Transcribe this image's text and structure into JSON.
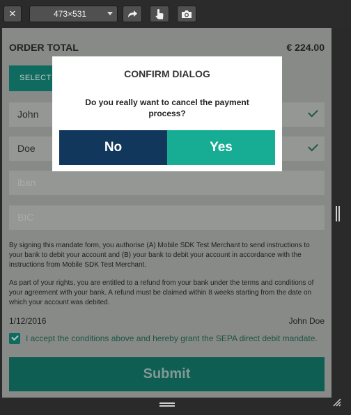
{
  "toolbar": {
    "close_label": "✕",
    "viewport_size": "473×531"
  },
  "form": {
    "order_total_label": "ORDER TOTAL",
    "order_total_value": "€ 224.00",
    "select_button_label": "SELECT A",
    "first_name_value": "John",
    "last_name_value": "Doe",
    "iban_placeholder": "iban",
    "bic_placeholder": "BIC",
    "mandate_text": "By signing this mandate form, you authorise (A) Mobile SDK Test Merchant to send instructions to your bank to debit your account and (B) your bank to debit your account in accordance with the instructions from Mobile SDK Test Merchant.",
    "rights_text": "As part of your rights, you are entitled to a refund from your bank under the terms and conditions of your agreement with your bank. A refund must be claimed within 8 weeks starting from the date on which your account was debited.",
    "date": "1/12/2016",
    "signer_name": "John Doe",
    "accept_text": "I accept the conditions above and hereby grant the SEPA direct debit mandate.",
    "submit_label": "Submit"
  },
  "dialog": {
    "title": "CONFIRM DIALOG",
    "message": "Do you really want to cancel the payment process?",
    "no_label": "No",
    "yes_label": "Yes"
  },
  "colors": {
    "toolbar_bg": "#2b2b2b",
    "overlay_bg": "#888a88",
    "teal_dark": "#0f6b5f",
    "dialog_no": "#12375c",
    "dialog_yes": "#17ad94"
  },
  "icons": [
    "close-icon",
    "chevron-down-icon",
    "rotate-icon",
    "touch-icon",
    "camera-icon",
    "checkmark-icon"
  ]
}
